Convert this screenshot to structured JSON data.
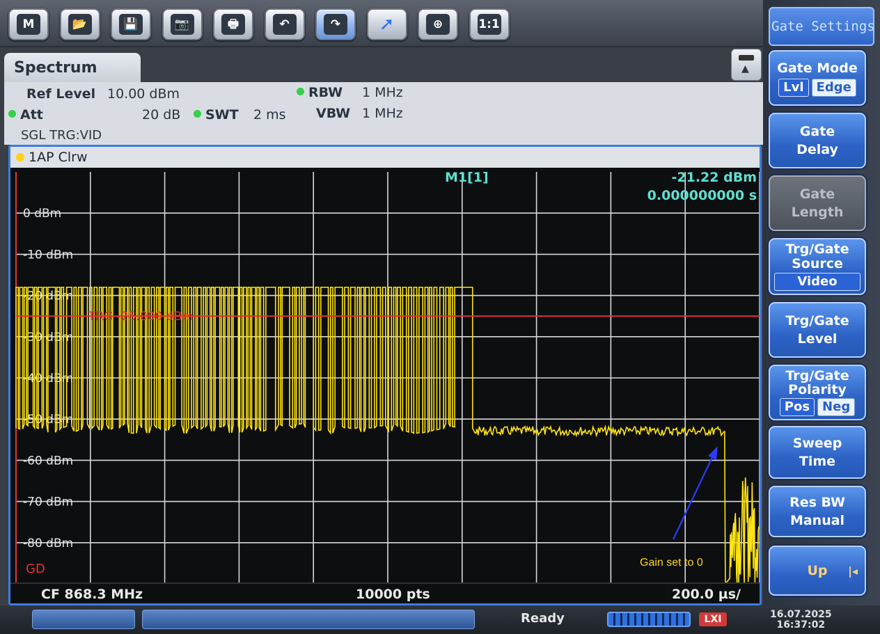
{
  "toolbar": {
    "buttons": [
      {
        "icon": "mode-icon",
        "glyph": "M"
      },
      {
        "icon": "open-folder-icon",
        "glyph": "📂"
      },
      {
        "icon": "save-icon",
        "glyph": "💾"
      },
      {
        "icon": "screenshot-icon",
        "glyph": "📷"
      },
      {
        "icon": "print-icon",
        "glyph": "🖶"
      },
      {
        "icon": "undo-icon",
        "glyph": "↶"
      },
      {
        "icon": "redo-icon",
        "glyph": "↷"
      },
      {
        "icon": "pointer-icon",
        "glyph": "➚"
      },
      {
        "icon": "zoom-icon",
        "glyph": "⊕"
      },
      {
        "icon": "zoom-reset-icon",
        "glyph": "1:1"
      }
    ]
  },
  "softkeys": {
    "title": "Gate Settings",
    "gate_mode": {
      "label": "Gate Mode",
      "opt1": "Lvl",
      "opt2": "Edge"
    },
    "gate_delay": {
      "line1": "Gate",
      "line2": "Delay"
    },
    "gate_length": {
      "line1": "Gate",
      "line2": "Length"
    },
    "trg_source": {
      "line1": "Trg/Gate",
      "line2": "Source",
      "value": "Video"
    },
    "trg_level": {
      "line1": "Trg/Gate",
      "line2": "Level"
    },
    "trg_polarity": {
      "line1": "Trg/Gate",
      "line2": "Polarity",
      "opt1": "Pos",
      "opt2": "Neg"
    },
    "sweep_time": {
      "line1": "Sweep",
      "line2": "Time"
    },
    "res_bw": {
      "line1": "Res BW",
      "line2": "Manual"
    },
    "up": {
      "label": "Up"
    }
  },
  "tab": {
    "label": "Spectrum"
  },
  "settings": {
    "ref_level_label": "Ref Level",
    "ref_level_value": "10.00 dBm",
    "att_label": "Att",
    "att_value": "20 dB",
    "swt_label": "SWT",
    "swt_value": "2 ms",
    "rbw_label": "RBW",
    "rbw_value": "1 MHz",
    "vbw_label": "VBW",
    "vbw_value": "1 MHz",
    "trigger_mode": "SGL TRG:VID"
  },
  "trace": {
    "label": "1AP Clrw"
  },
  "marker": {
    "name": "M1[1]",
    "level": "-21.22 dBm",
    "time": "0.000000000 s"
  },
  "trigger_line": {
    "label": "TRG -25.000 dBm"
  },
  "gate_indicator": "GD",
  "annotation": {
    "text": "Gain set to 0"
  },
  "footer": {
    "cf": "CF 868.3 MHz",
    "points": "10000 pts",
    "span": "200.0 µs/"
  },
  "status": {
    "ready": "Ready",
    "date": "16.07.2025",
    "time": "16:37:02",
    "lxi": "LXI"
  },
  "colors": {
    "trace": "#ffe414",
    "trigger": "#e03434",
    "grid": "#d8d8d8",
    "marker": "#5ee0d0",
    "annotation": "#ffd81a",
    "arrow": "#2a3cff"
  },
  "chart_data": {
    "type": "line",
    "x_unit": "µs",
    "xlim": [
      0,
      2000
    ],
    "ylim": [
      -90,
      10
    ],
    "y_ticks": [
      {
        "value": 0,
        "label": "0 dBm"
      },
      {
        "value": -10,
        "label": "-10 dBm"
      },
      {
        "value": -20,
        "label": "-20 dBm"
      },
      {
        "value": -30,
        "label": "-30 dBm"
      },
      {
        "value": -40,
        "label": "-40 dBm"
      },
      {
        "value": -50,
        "label": "-50 dBm"
      },
      {
        "value": -60,
        "label": "-60 dBm"
      },
      {
        "value": -70,
        "label": "-70 dBm"
      },
      {
        "value": -80,
        "label": "-80 dBm"
      }
    ],
    "grid": true,
    "trigger_level_dbm": -25,
    "high_level_dbm": -18,
    "low_level_dbm": -51,
    "pulse_train": [
      [
        0,
        6
      ],
      [
        10,
        8
      ],
      [
        22,
        6
      ],
      [
        32,
        14
      ],
      [
        50,
        6
      ],
      [
        60,
        10
      ],
      [
        74,
        8
      ],
      [
        86,
        20
      ],
      [
        110,
        8
      ],
      [
        122,
        6
      ],
      [
        136,
        14
      ],
      [
        156,
        6
      ],
      [
        168,
        8
      ],
      [
        180,
        12
      ],
      [
        198,
        6
      ],
      [
        210,
        8
      ],
      [
        224,
        6
      ],
      [
        234,
        10
      ],
      [
        250,
        6
      ],
      [
        260,
        18
      ],
      [
        282,
        6
      ],
      [
        292,
        8
      ],
      [
        304,
        6
      ],
      [
        316,
        8
      ],
      [
        328,
        6
      ],
      [
        338,
        10
      ],
      [
        352,
        6
      ],
      [
        364,
        8
      ],
      [
        378,
        6
      ],
      [
        388,
        12
      ],
      [
        404,
        6
      ],
      [
        414,
        8
      ],
      [
        428,
        18
      ],
      [
        452,
        6
      ],
      [
        464,
        8
      ],
      [
        478,
        6
      ],
      [
        488,
        10
      ],
      [
        504,
        6
      ],
      [
        514,
        8
      ],
      [
        526,
        6
      ],
      [
        536,
        12
      ],
      [
        552,
        6
      ],
      [
        562,
        8
      ],
      [
        574,
        6
      ],
      [
        584,
        14
      ],
      [
        602,
        6
      ],
      [
        612,
        8
      ],
      [
        624,
        6
      ],
      [
        634,
        10
      ],
      [
        648,
        6
      ],
      [
        658,
        8
      ],
      [
        672,
        26
      ],
      [
        706,
        6
      ],
      [
        716,
        20
      ],
      [
        744,
        6
      ],
      [
        754,
        8
      ],
      [
        768,
        6
      ],
      [
        778,
        22
      ],
      [
        806,
        8
      ],
      [
        820,
        20
      ],
      [
        846,
        6
      ],
      [
        858,
        20
      ],
      [
        884,
        10
      ],
      [
        900,
        12
      ],
      [
        918,
        6
      ],
      [
        928,
        8
      ],
      [
        940,
        10
      ],
      [
        956,
        8
      ],
      [
        970,
        10
      ],
      [
        986,
        8
      ],
      [
        1002,
        8
      ],
      [
        1016,
        6
      ],
      [
        1026,
        8
      ],
      [
        1040,
        10
      ],
      [
        1056,
        8
      ],
      [
        1070,
        8
      ],
      [
        1084,
        10
      ],
      [
        1100,
        8
      ],
      [
        1112,
        6
      ],
      [
        1124,
        8
      ],
      [
        1140,
        10
      ],
      [
        1156,
        8
      ],
      [
        1168,
        6
      ],
      [
        1180,
        48
      ]
    ],
    "burst_end_us": 1228,
    "noise_floor_end_us": 1908,
    "low_noise_segment": {
      "start_us": 1920,
      "end_us": 2000,
      "min_dbm": -90,
      "max_dbm": -64
    }
  }
}
